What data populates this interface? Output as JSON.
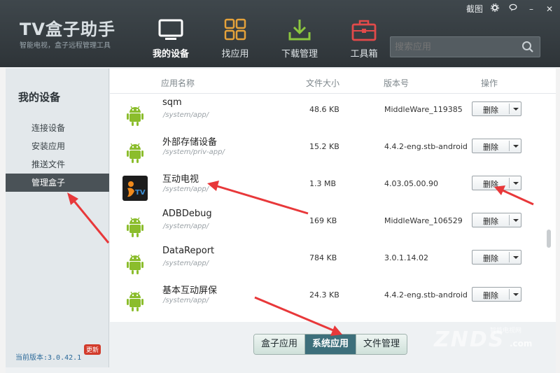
{
  "app": {
    "logo": "TV盒子助手",
    "tagline": "智能电视，盒子远程管理工具"
  },
  "window": {
    "screenshot_label": "截图",
    "gear_icon": "gear-icon",
    "feedback_icon": "feedback-icon",
    "minimize": "–",
    "close": "✕"
  },
  "nav": [
    {
      "label": "我的设备",
      "icon": "monitor-icon",
      "active": true
    },
    {
      "label": "找应用",
      "icon": "apps-grid-icon",
      "active": false
    },
    {
      "label": "下载管理",
      "icon": "download-icon",
      "active": false
    },
    {
      "label": "工具箱",
      "icon": "toolbox-icon",
      "active": false
    }
  ],
  "search": {
    "placeholder": "搜索应用"
  },
  "sidebar": {
    "title": "我的设备",
    "items": [
      {
        "label": "连接设备",
        "active": false
      },
      {
        "label": "安装应用",
        "active": false
      },
      {
        "label": "推送文件",
        "active": false
      },
      {
        "label": "管理盒子",
        "active": true
      }
    ],
    "version": "当前版本:3.0.42.1",
    "update_badge": "更新"
  },
  "table": {
    "headers": {
      "name": "应用名称",
      "size": "文件大小",
      "version": "版本号",
      "action": "操作"
    },
    "delete_label": "删除",
    "rows": [
      {
        "name": "sqm",
        "path": "/system/app/",
        "size": "48.6 KB",
        "version": "MiddleWare_119385",
        "icon": "android-icon"
      },
      {
        "name": "外部存储设备",
        "path": "/system/priv-app/",
        "size": "15.2 KB",
        "version": "4.4.2-eng.stb-android",
        "icon": "android-icon"
      },
      {
        "name": "互动电视",
        "path": "/system/app/",
        "size": "1.3 MB",
        "version": "4.03.05.00.90",
        "icon": "itv-logo-icon"
      },
      {
        "name": "ADBDebug",
        "path": "/system/app/",
        "size": "169 KB",
        "version": "MiddleWare_106529",
        "icon": "android-icon"
      },
      {
        "name": "DataReport",
        "path": "/system/app/",
        "size": "784 KB",
        "version": "3.0.1.14.02",
        "icon": "android-icon"
      },
      {
        "name": "基本互动屏保",
        "path": "/system/app/",
        "size": "24.3 KB",
        "version": "4.4.2-eng.stb-android",
        "icon": "android-icon"
      }
    ]
  },
  "tabs": [
    {
      "label": "盒子应用",
      "active": false
    },
    {
      "label": "系统应用",
      "active": true
    },
    {
      "label": "文件管理",
      "active": false
    }
  ],
  "watermark": {
    "brand": "ZNDS",
    "sub": "智能电视网",
    "suffix": ".com"
  },
  "colors": {
    "annotation_arrow": "#e8383a",
    "active_tab": "#3d6f7b",
    "titlebar": "#3a4247"
  }
}
